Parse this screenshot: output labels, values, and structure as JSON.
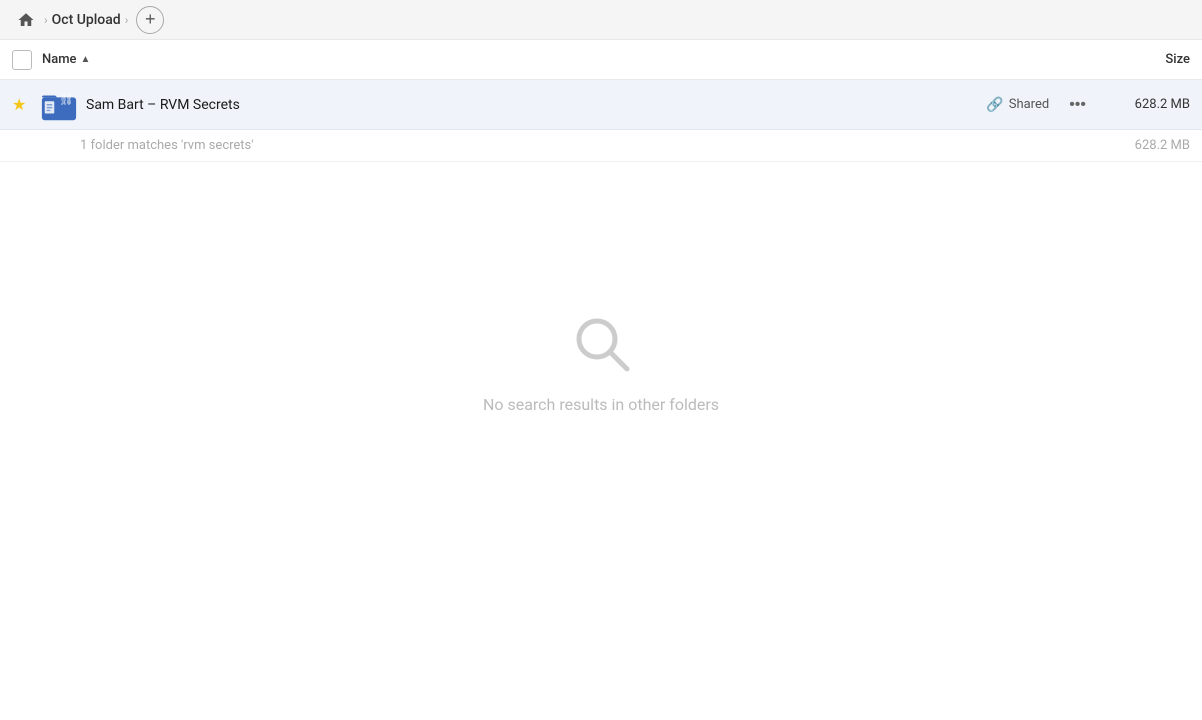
{
  "breadcrumb": {
    "home_icon": "home",
    "folder_label": "Oct Upload",
    "add_button_label": "+"
  },
  "columns": {
    "name_label": "Name",
    "sort_indicator": "▲",
    "size_label": "Size"
  },
  "file_row": {
    "star": "★",
    "name": "Sam Bart – RVM Secrets",
    "shared_label": "Shared",
    "more_options_label": "•••",
    "size": "628.2 MB"
  },
  "matches_info": {
    "text": "1 folder matches 'rvm secrets'",
    "size": "628.2 MB"
  },
  "empty_state": {
    "message": "No search results in other folders"
  }
}
